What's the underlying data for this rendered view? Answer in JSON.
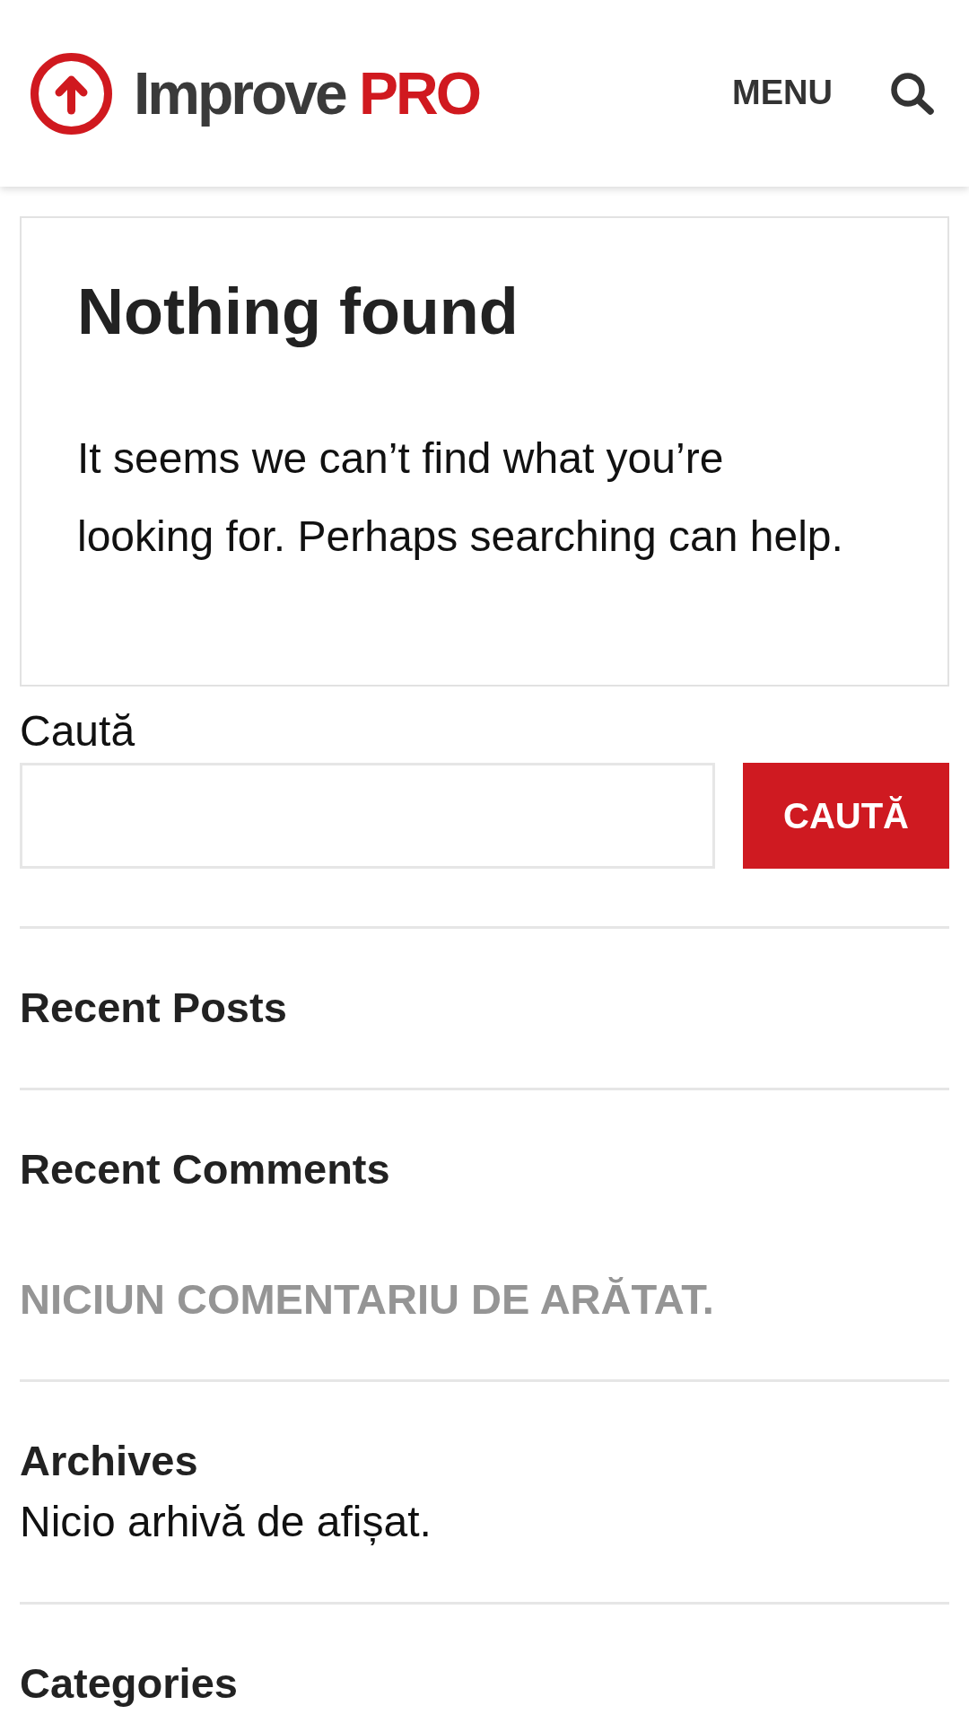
{
  "header": {
    "logo": {
      "name": "Improve",
      "suffix": "PRO"
    },
    "menu_label": "MENU"
  },
  "notice": {
    "title": "Nothing found",
    "message": "It seems we can’t find what you’re looking for. Perhaps searching can help."
  },
  "search_form": {
    "label": "Caută",
    "button": "CAUTĂ"
  },
  "widgets": [
    {
      "title": "Recent Posts"
    },
    {
      "title": "Recent Comments",
      "note": {
        "kind": "muted",
        "text": "NICIUN COMENTARIU DE ARĂTAT."
      }
    },
    {
      "title": "Archives",
      "note": {
        "kind": "plain",
        "text": "Nicio arhivă de afișat."
      }
    },
    {
      "title": "Categories"
    }
  ]
}
